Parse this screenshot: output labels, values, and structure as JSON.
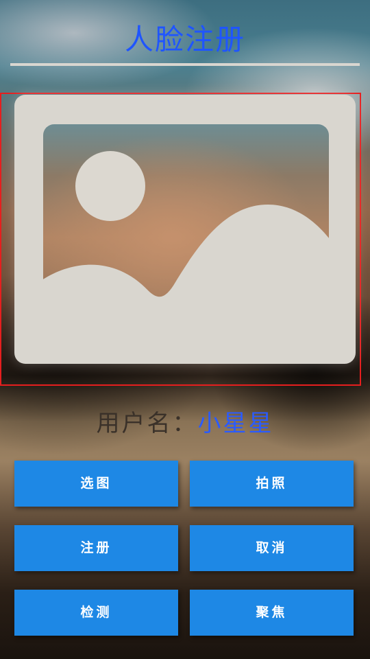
{
  "header": {
    "title": "人脸注册"
  },
  "preview": {
    "icon": "image-placeholder-icon",
    "frame_color": "#e61e1e"
  },
  "user": {
    "label": "用户名：",
    "name": "小星星"
  },
  "buttons": {
    "select_image": "选图",
    "take_photo": "拍照",
    "register": "注册",
    "cancel": "取消",
    "detect": "检测",
    "focus": "聚焦"
  },
  "colors": {
    "accent": "#1f55ff",
    "button": "#1e88e5",
    "button_text": "#ffffff"
  }
}
